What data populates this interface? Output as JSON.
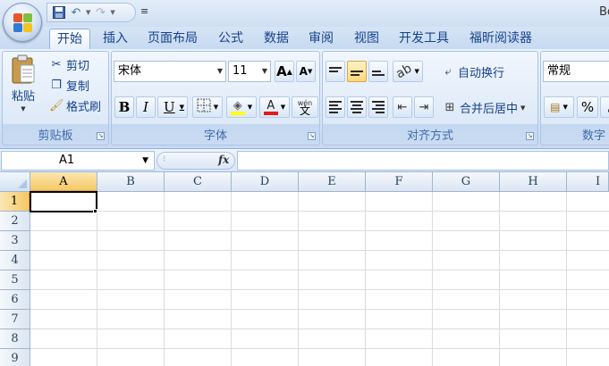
{
  "title": {
    "window_title": "Bo"
  },
  "quick_access": {
    "customize_glyph": "≡"
  },
  "tabs": [
    {
      "label": "开始",
      "active": true
    },
    {
      "label": "插入"
    },
    {
      "label": "页面布局"
    },
    {
      "label": "公式"
    },
    {
      "label": "数据"
    },
    {
      "label": "审阅"
    },
    {
      "label": "视图"
    },
    {
      "label": "开发工具"
    },
    {
      "label": "福昕阅读器"
    }
  ],
  "ribbon": {
    "clipboard": {
      "label": "剪贴板",
      "paste": "粘贴",
      "cut": "剪切",
      "copy": "复制",
      "format_painter": "格式刷"
    },
    "font": {
      "label": "字体",
      "font_name": "宋体",
      "font_size": "11",
      "bold": "B",
      "italic": "I",
      "underline": "U",
      "grow_font": "A",
      "shrink_font": "A",
      "font_color_glyph": "A",
      "phonetic": "wén"
    },
    "alignment": {
      "label": "对齐方式",
      "wrap_text": "自动换行",
      "merge_center": "合并后居中"
    },
    "number": {
      "label": "数字",
      "format": "常规",
      "percent": "%"
    }
  },
  "formula_bar": {
    "name_box": "A1",
    "fx": "fx",
    "formula": ""
  },
  "sheet": {
    "columns": [
      "A",
      "B",
      "C",
      "D",
      "E",
      "F",
      "G",
      "H",
      "I"
    ],
    "rows": [
      "1",
      "2",
      "3",
      "4",
      "5",
      "6",
      "7",
      "8",
      "9"
    ],
    "active_cell": "A1"
  },
  "colors": {
    "ribbon_bg": "#dbe7f7",
    "selection_header": "#f5c864",
    "text_accent": "#15428b"
  }
}
